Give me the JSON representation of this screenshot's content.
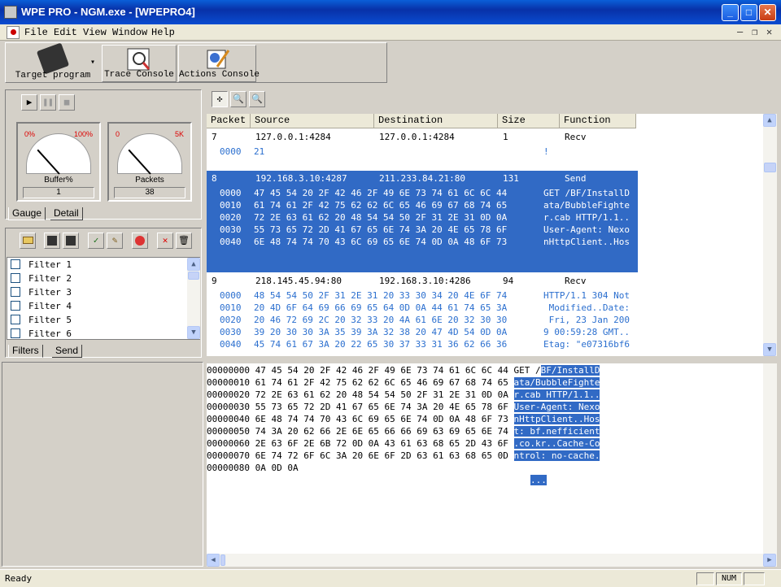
{
  "window": {
    "title": "WPE PRO - NGM.exe - [WPEPRO4]",
    "btn_min": "_",
    "btn_max": "□",
    "btn_close": "✕"
  },
  "menu": {
    "file": "File",
    "edit": "Edit",
    "view": "View",
    "window": "Window",
    "help": "Help"
  },
  "mdi": {
    "min": "–",
    "restore": "❐",
    "close": "✕"
  },
  "toolbar": {
    "target_program": "Target program",
    "trace_console": "Trace Console",
    "actions_console": "Actions Console",
    "dropdown": "▾"
  },
  "controls": {
    "play": "▶",
    "pause": "❚❚",
    "stop": "■"
  },
  "gauges": [
    {
      "caption": "Buffer%",
      "lo": "0%",
      "hi": "100%",
      "value": "1"
    },
    {
      "caption": "Packets",
      "lo": "0",
      "hi": "5K",
      "value": "38"
    }
  ],
  "gauge_tabs": {
    "gauge": "Gauge",
    "detail": "Detail"
  },
  "filters": [
    "Filter 1",
    "Filter 2",
    "Filter 3",
    "Filter 4",
    "Filter 5",
    "Filter 6"
  ],
  "filter_tabs": {
    "filters": "Filters",
    "send": "Send"
  },
  "columns": {
    "packet": "Packet",
    "source": "Source",
    "destination": "Destination",
    "size": "Size",
    "function": "Function"
  },
  "packets": [
    {
      "no": "7",
      "src": "127.0.0.1:4284",
      "dst": "127.0.0.1:4284",
      "size": "1",
      "func": "Recv",
      "lines": [
        {
          "off": "0000",
          "hex": "21",
          "asc": "!"
        }
      ]
    },
    {
      "no": "8",
      "src": "192.168.3.10:4287",
      "dst": "211.233.84.21:80",
      "size": "131",
      "func": "Send",
      "lines": [
        {
          "off": "0000",
          "hex": "47 45 54 20 2F 42 46 2F 49 6E 73 74 61 6C 6C 44",
          "asc": "GET /BF/InstallD"
        },
        {
          "off": "0010",
          "hex": "61 74 61 2F 42 75 62 62 6C 65 46 69 67 68 74 65",
          "asc": "ata/BubbleFighte"
        },
        {
          "off": "0020",
          "hex": "72 2E 63 61 62 20 48 54 54 50 2F 31 2E 31 0D 0A",
          "asc": "r.cab HTTP/1.1.."
        },
        {
          "off": "0030",
          "hex": "55 73 65 72 2D 41 67 65 6E 74 3A 20 4E 65 78 6F",
          "asc": "User-Agent: Nexo"
        },
        {
          "off": "0040",
          "hex": "6E 48 74 74 70 43 6C 69 65 6E 74 0D 0A 48 6F 73",
          "asc": "nHttpClient..Hos"
        }
      ]
    },
    {
      "no": "9",
      "src": "218.145.45.94:80",
      "dst": "192.168.3.10:4286",
      "size": "94",
      "func": "Recv",
      "lines": [
        {
          "off": "0000",
          "hex": "48 54 54 50 2F 31 2E 31 20 33 30 34 20 4E 6F 74",
          "asc": "HTTP/1.1 304 Not"
        },
        {
          "off": "0010",
          "hex": "20 4D 6F 64 69 66 69 65 64 0D 0A 44 61 74 65 3A",
          "asc": " Modified..Date:"
        },
        {
          "off": "0020",
          "hex": "20 46 72 69 2C 20 32 33 20 4A 61 6E 20 32 30 30",
          "asc": " Fri, 23 Jan 200"
        },
        {
          "off": "0030",
          "hex": "39 20 30 30 3A 35 39 3A 32 38 20 47 4D 54 0D 0A",
          "asc": "9 00:59:28 GMT.."
        },
        {
          "off": "0040",
          "hex": "45 74 61 67 3A 20 22 65 30 37 33 31 36 62 66 36",
          "asc": "Etag: \"e07316bf6"
        }
      ]
    }
  ],
  "hexdump": [
    {
      "off": "00000000",
      "hex": "47 45 54 20 2F 42 46 2F 49 6E 73 74 61 6C 6C 44",
      "asc_plain": "GET /",
      "asc_sel": "BF/InstallD"
    },
    {
      "off": "00000010",
      "hex": "61 74 61 2F 42 75 62 62 6C 65 46 69 67 68 74 65",
      "asc_plain": "",
      "asc_sel": "ata/BubbleFighte"
    },
    {
      "off": "00000020",
      "hex": "72 2E 63 61 62 20 48 54 54 50 2F 31 2E 31 0D 0A",
      "asc_plain": "",
      "asc_sel": "r.cab HTTP/1.1.."
    },
    {
      "off": "00000030",
      "hex": "55 73 65 72 2D 41 67 65 6E 74 3A 20 4E 65 78 6F",
      "asc_plain": "",
      "asc_sel": "User-Agent: Nexo"
    },
    {
      "off": "00000040",
      "hex": "6E 48 74 74 70 43 6C 69 65 6E 74 0D 0A 48 6F 73",
      "asc_plain": "",
      "asc_sel": "nHttpClient..Hos"
    },
    {
      "off": "00000050",
      "hex": "74 3A 20 62 66 2E 6E 65 66 66 69 63 69 65 6E 74",
      "asc_plain": "",
      "asc_sel": "t: bf.nefficient"
    },
    {
      "off": "00000060",
      "hex": "2E 63 6F 2E 6B 72 0D 0A 43 61 63 68 65 2D 43 6F",
      "asc_plain": "",
      "asc_sel": ".co.kr..Cache-Co"
    },
    {
      "off": "00000070",
      "hex": "6E 74 72 6F 6C 3A 20 6E 6F 2D 63 61 63 68 65 0D",
      "asc_plain": "",
      "asc_sel": "ntrol: no-cache."
    },
    {
      "off": "00000080",
      "hex": "0A 0D 0A",
      "asc_plain": "",
      "asc_sel": "..."
    }
  ],
  "status": {
    "text": "Ready",
    "num": "NUM"
  },
  "colors": {
    "selection": "#316ac5",
    "hex_text": "#2b6fcf",
    "titlebar": "#0a4cd0"
  }
}
